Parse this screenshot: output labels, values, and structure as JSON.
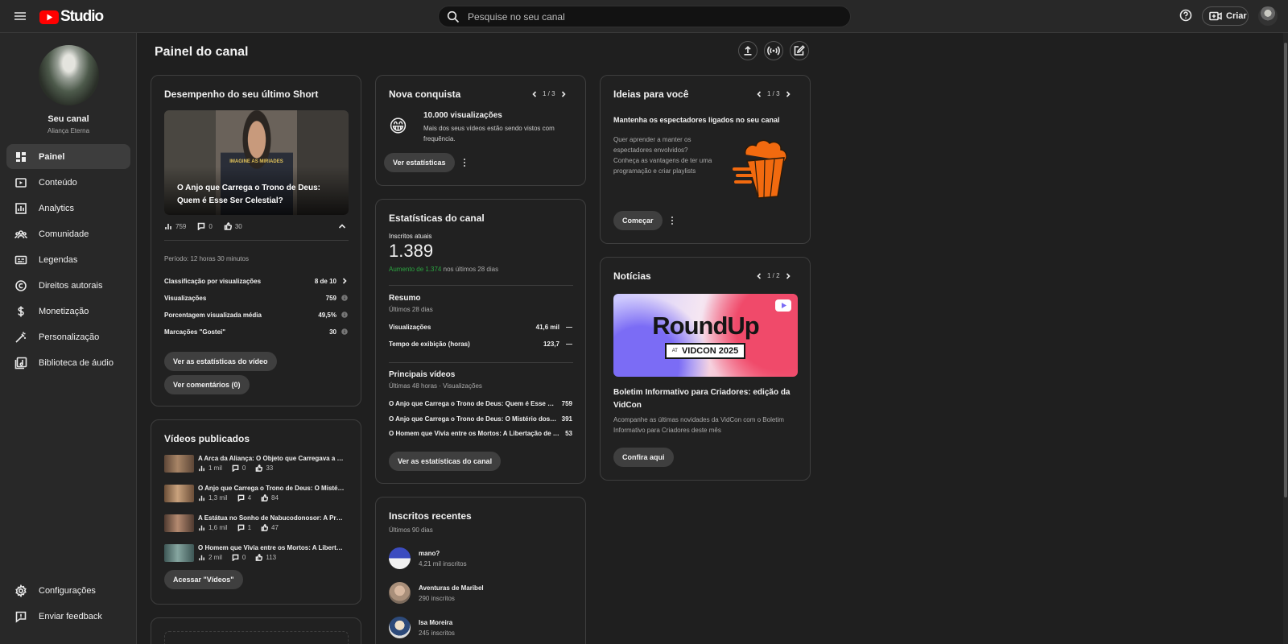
{
  "app": {
    "logo_text": "Studio",
    "brand_color": "#ff0000"
  },
  "search": {
    "placeholder": "Pesquise no seu canal"
  },
  "topbar": {
    "create_label": "Criar"
  },
  "channel": {
    "name": "Seu canal",
    "handle": "Aliança Eterna"
  },
  "sidebar": {
    "items": [
      {
        "label": "Painel",
        "icon": "dashboard-icon",
        "active": true
      },
      {
        "label": "Conteúdo",
        "icon": "content-icon"
      },
      {
        "label": "Analytics",
        "icon": "analytics-icon"
      },
      {
        "label": "Comunidade",
        "icon": "community-icon"
      },
      {
        "label": "Legendas",
        "icon": "subtitles-icon"
      },
      {
        "label": "Direitos autorais",
        "icon": "copyright-icon"
      },
      {
        "label": "Monetização",
        "icon": "monetization-icon"
      },
      {
        "label": "Personalização",
        "icon": "customization-icon"
      },
      {
        "label": "Biblioteca de áudio",
        "icon": "audio-library-icon"
      }
    ],
    "settings_label": "Configurações",
    "feedback_label": "Enviar feedback"
  },
  "page": {
    "title": "Painel do canal"
  },
  "short_card": {
    "title": "Desempenho do seu último Short",
    "thumb_caption": "O Anjo que Carrega o Trono de Deus: Quem é Esse Ser Celestial?",
    "thumb_overlay_text": "IMAGINE AS MIRIADES",
    "views": "759",
    "comments": "0",
    "likes": "30",
    "period": "Período: 12 horas 30 minutos",
    "metrics": [
      {
        "label": "Classificação por visualizações",
        "value": "8 de 10",
        "trail": "chevron"
      },
      {
        "label": "Visualizações",
        "value": "759",
        "trail": "info"
      },
      {
        "label": "Porcentagem visualizada média",
        "value": "49,5%",
        "trail": "info"
      },
      {
        "label": "Marcações \"Gostei\"",
        "value": "30",
        "trail": "info"
      }
    ],
    "stats_button": "Ver as estatísticas do vídeo",
    "comments_button": "Ver comentários (0)"
  },
  "videos_card": {
    "title": "Vídeos publicados",
    "videos": [
      {
        "title": "A Arca da Aliança: O Objeto que Carregava a Presença de Deus",
        "views": "1 mil",
        "comments": "0",
        "likes": "33",
        "thumb_color": "#8a6a52"
      },
      {
        "title": "O Anjo que Carrega o Trono de Deus: O Mistério dos Querubins",
        "views": "1,3 mil",
        "comments": "4",
        "likes": "84",
        "thumb_color": "#9b7a5c"
      },
      {
        "title": "A Estátua no Sonho de Nabucodonosor: A Profecia dos Impérios",
        "views": "1,6 mil",
        "comments": "1",
        "likes": "47",
        "thumb_color": "#7b5a48"
      },
      {
        "title": "O Homem que Vivia entre os Mortos: A Libertação de Gadara",
        "views": "2 mil",
        "comments": "0",
        "likes": "113",
        "thumb_color": "#4f6b6a"
      }
    ],
    "button": "Acessar \"Vídeos\""
  },
  "achievement_card": {
    "title": "Nova conquista",
    "pager": "1 / 3",
    "emoji": "😁",
    "headline": "10.000 visualizações",
    "description": "Mais dos seus vídeos estão sendo vistos com frequência.",
    "button": "Ver estatísticas"
  },
  "analytics_card": {
    "title": "Estatísticas do canal",
    "subs_label": "Inscritos atuais",
    "subs_value": "1.389",
    "subs_delta": "Aumento de 1.374",
    "subs_delta_suffix": " nos últimos 28 dias",
    "delta_color": "#2ba640",
    "summary_title": "Resumo",
    "summary_period": "Últimos 28 dias",
    "summary_rows": [
      {
        "label": "Visualizações",
        "value": "41,6 mil",
        "trend": "—"
      },
      {
        "label": "Tempo de exibição (horas)",
        "value": "123,7",
        "trend": "—"
      }
    ],
    "top_title": "Principais vídeos",
    "top_period": "Últimas 48 horas · Visualizações",
    "top_videos": [
      {
        "title": "O Anjo que Carrega o Trono de Deus: Quem é Esse Ser Celestial?",
        "value": "759"
      },
      {
        "title": "O Anjo que Carrega o Trono de Deus: O Mistério dos Querubins",
        "value": "391"
      },
      {
        "title": "O Homem que Vivia entre os Mortos: A Libertação de Gadara",
        "value": "53"
      }
    ],
    "button": "Ver as estatísticas do canal"
  },
  "subscribers_card": {
    "title": "Inscritos recentes",
    "period": "Últimos 90 dias",
    "subs": [
      {
        "name": "mano?",
        "count": "4,21 mil inscritos"
      },
      {
        "name": "Aventuras de Maribel",
        "count": "290 inscritos"
      },
      {
        "name": "Isa Moreira",
        "count": "245 inscritos"
      }
    ]
  },
  "ideas_card": {
    "title": "Ideias para você",
    "pager": "1 / 3",
    "headline": "Mantenha os espectadores ligados no seu canal",
    "body": "Quer aprender a manter os espectadores envolvidos? Conheça as vantagens de ter uma programação e criar playlists",
    "button": "Começar",
    "accent": "#f26a0f"
  },
  "news_card": {
    "title": "Notícias",
    "pager": "1 / 2",
    "banner_title": "RoundUp",
    "banner_badge_prefix": "AT",
    "banner_badge": "VIDCON 2025",
    "headline": "Boletim Informativo para Criadores: edição da VidCon",
    "body": "Acompanhe as últimas novidades da VidCon com o Boletim Informativo para Criadores deste mês",
    "button": "Confira aqui"
  }
}
